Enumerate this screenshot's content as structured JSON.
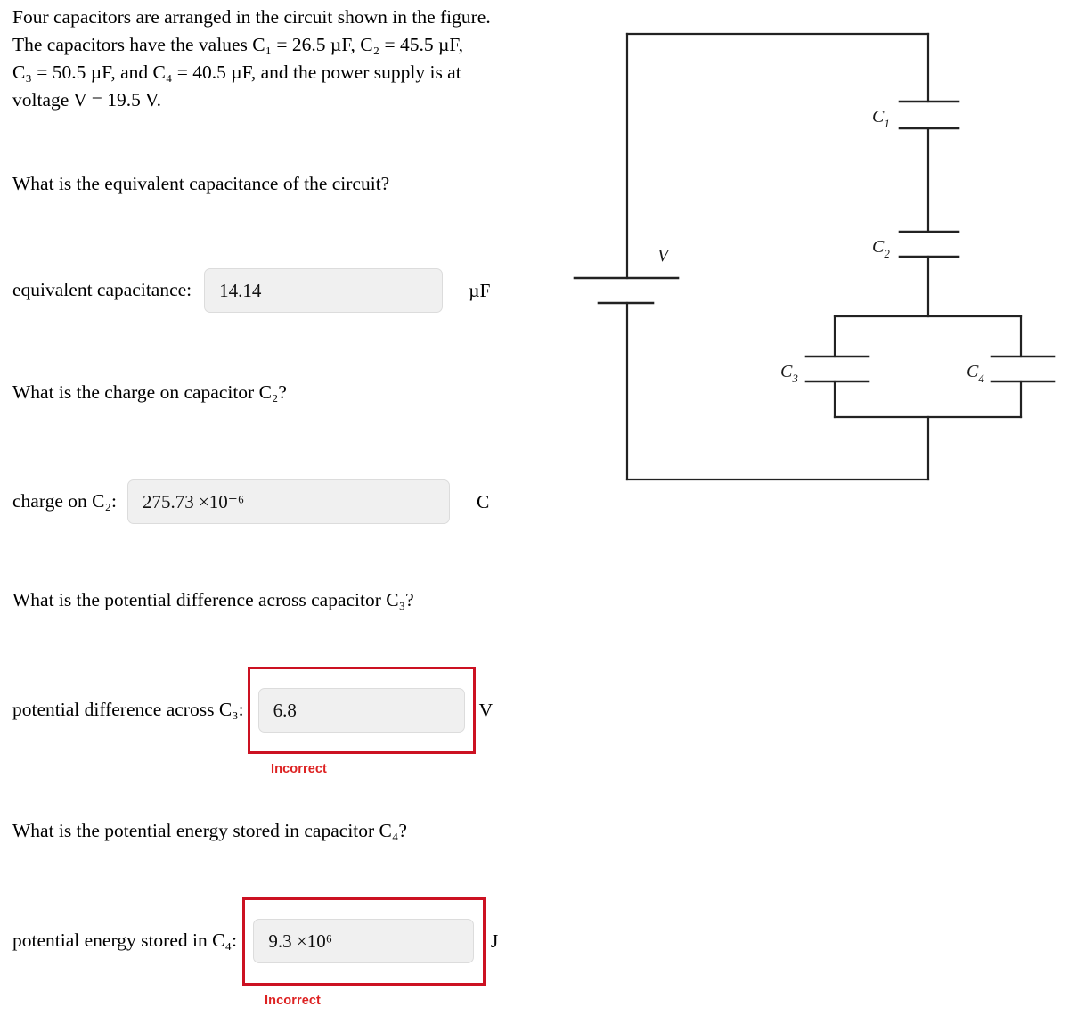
{
  "problem": {
    "intro_lines": [
      "Four capacitors are arranged in the circuit shown in the figure.",
      "The capacitors have the values C₁ = 26.5 µF, C₂ = 45.5 µF,",
      "C₃ = 50.5 µF, and C₄ = 40.5 µF, and the power supply is at",
      "voltage V = 19.5 V."
    ],
    "given": {
      "C1": "26.5 µF",
      "C2": "45.5 µF",
      "C3": "50.5 µF",
      "C4": "40.5 µF",
      "V": "19.5 V"
    }
  },
  "questions": [
    {
      "id": "q1",
      "prompt": "What is the equivalent capacitance of the circuit?",
      "answer_label": "equivalent capacitance:",
      "value": "14.14",
      "unit": "µF",
      "status": "none",
      "status_text": ""
    },
    {
      "id": "q2",
      "prompt": "What is the charge on capacitor C₂?",
      "answer_label": "charge on C₂:",
      "value": "275.73  ×10⁻⁶",
      "value_mantissa": "275.73",
      "value_exponent": "-6",
      "unit": "C",
      "status": "none",
      "status_text": ""
    },
    {
      "id": "q3",
      "prompt": "What is the potential difference across capacitor C₃?",
      "answer_label": "potential difference across C₃:",
      "value": "6.8",
      "unit": "V",
      "status": "incorrect",
      "status_text": "Incorrect"
    },
    {
      "id": "q4",
      "prompt": "What is the potential energy stored in capacitor C₄?",
      "answer_label": "potential energy stored in C₄:",
      "value": "9.3  ×10⁶",
      "value_mantissa": "9.3",
      "value_exponent": "6",
      "unit": "J",
      "status": "incorrect",
      "status_text": "Incorrect"
    }
  ],
  "figure": {
    "caption": "capacitor circuit diagram",
    "labels": {
      "source": "V",
      "c1": "C",
      "c1_sub": "1",
      "c2": "C",
      "c2_sub": "2",
      "c3": "C",
      "c3_sub": "3",
      "c4": "C",
      "c4_sub": "4"
    }
  },
  "colors": {
    "error": "#cc1122",
    "error_text": "#dd2222",
    "field_bg": "#f0f0f0",
    "wire": "#222222"
  }
}
